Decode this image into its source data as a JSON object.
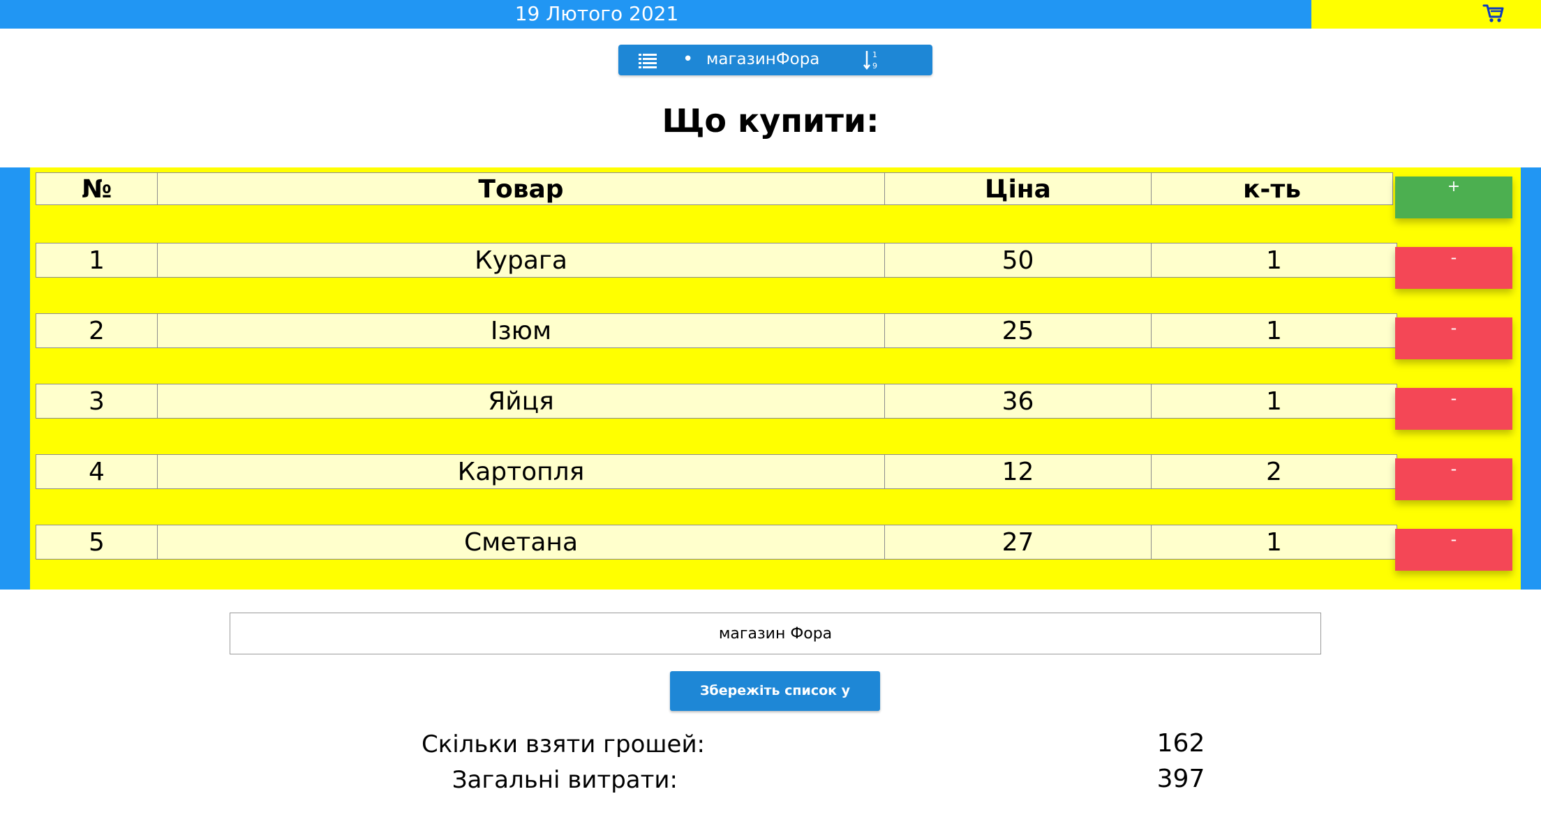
{
  "header": {
    "date": "19 Лютого 2021",
    "cart_icon": "cart-icon",
    "colors": {
      "blue": "#2196f3",
      "yellow": "#ffff00"
    }
  },
  "shop_selector": {
    "list_icon": "list-icon",
    "bullet": "•",
    "shop_name": "магазинФора",
    "sort_icon": "sort-numeric-icon"
  },
  "title": "Що купити:",
  "table": {
    "headers": {
      "num": "№",
      "item": "Товар",
      "price": "Ціна",
      "qty": "к-ть"
    },
    "add_label": "+",
    "delete_label": "-",
    "rows": [
      {
        "num": "1",
        "item": "Курага",
        "price": "50",
        "qty": "1"
      },
      {
        "num": "2",
        "item": "Ізюм",
        "price": "25",
        "qty": "1"
      },
      {
        "num": "3",
        "item": "Яйця",
        "price": "36",
        "qty": "1"
      },
      {
        "num": "4",
        "item": "Картопля",
        "price": "12",
        "qty": "2"
      },
      {
        "num": "5",
        "item": "Сметана",
        "price": "27",
        "qty": "1"
      }
    ],
    "colors": {
      "cell_bg": "#ffffcc",
      "add": "#4caf50",
      "delete": "#f44756"
    }
  },
  "shop_input": {
    "value": "магазин Фора"
  },
  "save_button": {
    "label": "Збережіть список у колекцію"
  },
  "summary": {
    "money_label": "Скільки взяти грошей:",
    "money_value": "162",
    "total_label": "Загальні витрати:",
    "total_value": "397"
  }
}
